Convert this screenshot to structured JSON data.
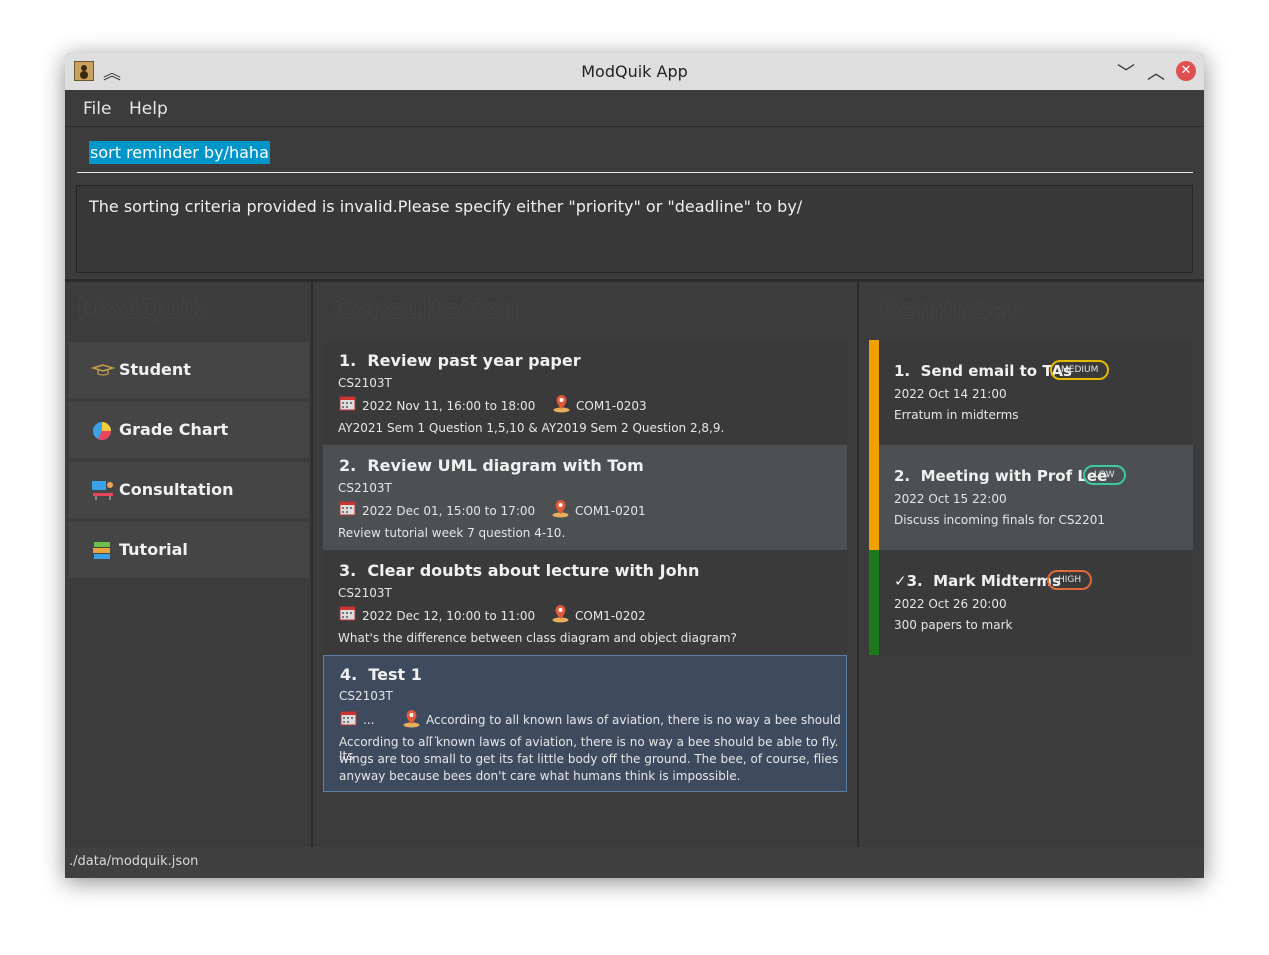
{
  "window": {
    "title": "ModQuik App"
  },
  "menu": {
    "file": "File",
    "help": "Help"
  },
  "command": {
    "value": "sort reminder by/haha"
  },
  "result": {
    "text": "The sorting criteria provided is invalid.Please specify either \"priority\" or \"deadline\" to by/"
  },
  "sidebar": {
    "title": "ModQuik",
    "items": [
      {
        "label": "Student",
        "icon": "graduation-cap-icon"
      },
      {
        "label": "Grade Chart",
        "icon": "pie-chart-icon"
      },
      {
        "label": "Consultation",
        "icon": "consultation-icon"
      },
      {
        "label": "Tutorial",
        "icon": "books-icon"
      }
    ]
  },
  "consultation": {
    "title": "Consultation",
    "items": [
      {
        "index": "1.",
        "title": "Review past year paper",
        "module": "CS2103T",
        "when": "2022 Nov 11, 16:00 to 18:00",
        "location": "COM1-0203",
        "description": "AY2021 Sem 1 Question 1,5,10 & AY2019 Sem 2 Question 2,8,9."
      },
      {
        "index": "2.",
        "title": "Review UML diagram with Tom",
        "module": "CS2103T",
        "when": "2022 Dec 01, 15:00 to 17:00",
        "location": "COM1-0201",
        "description": "Review tutorial week 7 question 4-10."
      },
      {
        "index": "3.",
        "title": "Clear doubts about lecture with John",
        "module": "CS2103T",
        "when": "2022 Dec 12, 10:00 to 11:00",
        "location": "COM1-0202",
        "description": "What's the difference between class diagram and object diagram?"
      },
      {
        "index": "4.",
        "title": "Test 1",
        "module": "CS2103T",
        "when": "...",
        "location": "According to all known laws of aviation, there is no way a bee should ...",
        "description_lines": [
          "According to all known laws of aviation, there is no way a bee should be able to fly. Its",
          "wings are too small to get its fat little body off the ground. The bee, of course, flies",
          "anyway because bees don't care what humans think is impossible."
        ]
      }
    ]
  },
  "reminder": {
    "title": "Reminder",
    "items": [
      {
        "index": "1.",
        "title": "Send email to TAs",
        "priority": "MEDIUM",
        "deadline": "2022 Oct 14 21:00",
        "description": "Erratum in midterms",
        "bar_color": "#f0a000",
        "badge_color": "#e6b800"
      },
      {
        "index": "2.",
        "title": "Meeting with Prof Lee",
        "priority": "LOW",
        "deadline": "2022 Oct 15 22:00",
        "description": "Discuss incoming finals for CS2201",
        "bar_color": "#f0a000",
        "badge_color": "#3ec9a0"
      },
      {
        "index": "✓3.",
        "title": "Mark Midterms",
        "priority": "HIGH",
        "deadline": "2022 Oct 26 20:00",
        "description": "300 papers to mark",
        "bar_color": "#1c7a1c",
        "badge_color": "#e06a3a"
      }
    ]
  },
  "status": {
    "path": "./data/modquik.json"
  }
}
